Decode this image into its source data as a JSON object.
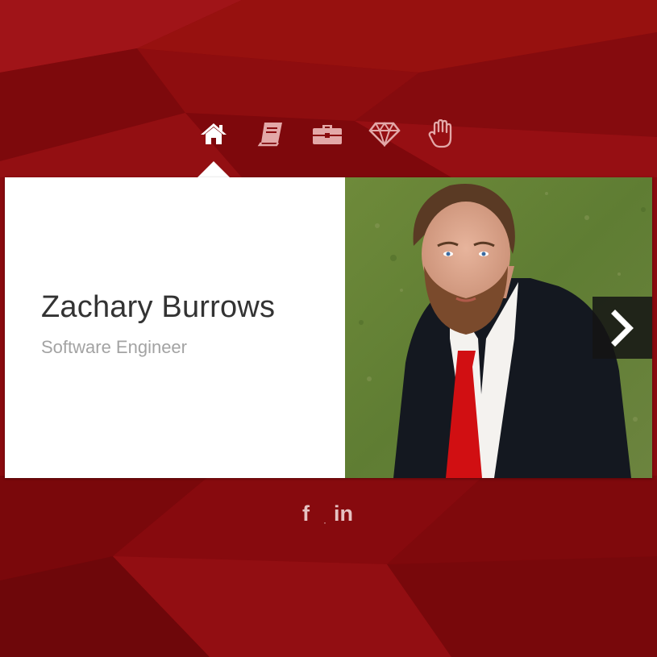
{
  "nav": {
    "items": [
      {
        "icon": "home-icon",
        "active": true
      },
      {
        "icon": "book-icon",
        "active": false
      },
      {
        "icon": "briefcase-icon",
        "active": false
      },
      {
        "icon": "diamond-icon",
        "active": false
      },
      {
        "icon": "hand-icon",
        "active": false
      }
    ]
  },
  "profile": {
    "name": "Zachary Burrows",
    "title": "Software Engineer",
    "photo_icon": "profile-photo"
  },
  "carousel": {
    "next_icon": "chevron-right-icon"
  },
  "social": {
    "facebook_label": "f",
    "separator": "·",
    "linkedin_label": "in"
  },
  "colors": {
    "background": "#8a0b0f",
    "card": "#ffffff",
    "name_text": "#333333",
    "title_text": "#a3a3a3",
    "icon_active": "#ffffff",
    "icon_inactive": "#e3a8a8"
  }
}
